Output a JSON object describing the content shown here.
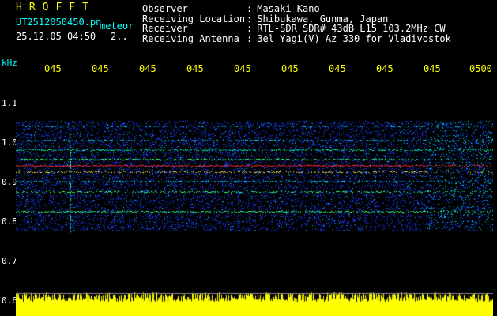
{
  "header": {
    "brand": "HROFFT",
    "filename": "UT2512050450.pn",
    "meteor_label": "meteor",
    "datetime": "25.12.05 04:50",
    "counter": "2.."
  },
  "info": {
    "rows": [
      {
        "label": "Observer",
        "sep": ":",
        "value": "Masaki Kano"
      },
      {
        "label": "Receiving Location",
        "sep": ":",
        "value": "Shibukawa, Gunma, Japan"
      },
      {
        "label": "Receiver",
        "sep": ":",
        "value": "RTL-SDR SDR# 43dB L15 103.2MHz CW"
      },
      {
        "label": "Receiving Antenna",
        "sep": ":",
        "value": "3el Yagi(V) Az 330 for Vladivostok"
      }
    ]
  },
  "axes": {
    "y_unit": "kHz",
    "y_ticks": [
      "1.1",
      "1.0",
      "0.9",
      "0.8",
      "0.7",
      "0.6"
    ],
    "x_ticks": [
      "045",
      "045",
      "045",
      "045",
      "045",
      "045",
      "045",
      "045",
      "045",
      "0500"
    ]
  },
  "colors": {
    "background": "#000000",
    "text_cyan": "#00ffff",
    "text_white": "#ffffff",
    "text_yellow": "#ffff00",
    "noise_blue": "#1a3cff",
    "signal_red": "#ff2020"
  }
}
